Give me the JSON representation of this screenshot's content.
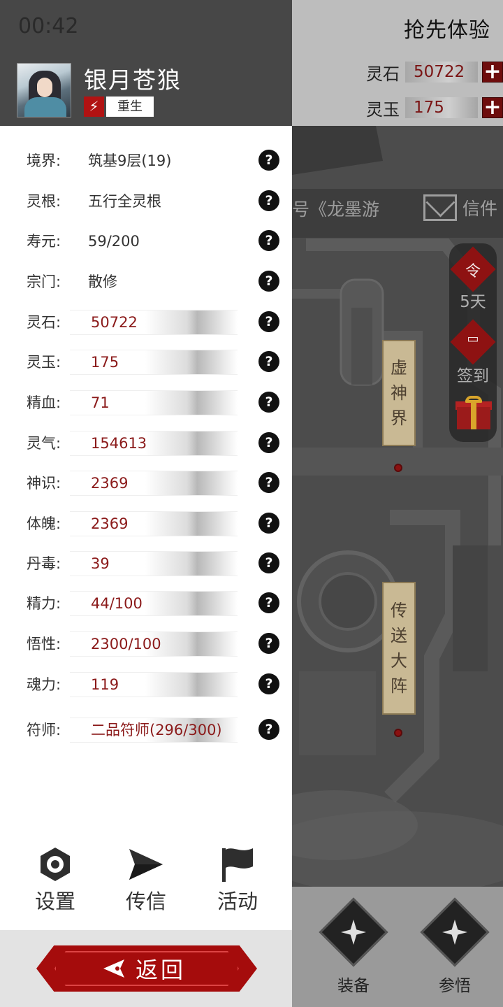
{
  "status_bar": {
    "time": "00:42"
  },
  "player": {
    "name": "银月苍狼",
    "status_icon": "lightning-icon",
    "status_label": "重生"
  },
  "stats": [
    {
      "label": "境界:",
      "value": "筑基9层(19)",
      "style": "plain"
    },
    {
      "label": "灵根:",
      "value": "五行全灵根",
      "style": "plain"
    },
    {
      "label": "寿元:",
      "value": "59/200",
      "style": "plain"
    },
    {
      "label": "宗门:",
      "value": "散修",
      "style": "plain"
    },
    {
      "label": "灵石:",
      "value": "50722",
      "style": "bar"
    },
    {
      "label": "灵玉:",
      "value": "175",
      "style": "bar"
    },
    {
      "label": "精血:",
      "value": "71",
      "style": "bar"
    },
    {
      "label": "灵气:",
      "value": "154613",
      "style": "bar"
    },
    {
      "label": "神识:",
      "value": "2369",
      "style": "bar"
    },
    {
      "label": "体魄:",
      "value": "2369",
      "style": "bar"
    },
    {
      "label": "丹毒:",
      "value": "39",
      "style": "bar"
    },
    {
      "label": "精力:",
      "value": "44/100",
      "style": "bar"
    },
    {
      "label": "悟性:",
      "value": "2300/100",
      "style": "bar"
    },
    {
      "label": "魂力:",
      "value": "119",
      "style": "bar"
    },
    {
      "label": "符师:",
      "value": "二品符师(296/300)",
      "style": "bar"
    }
  ],
  "help_glyph": "?",
  "menu": {
    "settings": {
      "label": "设置",
      "icon": "gear-icon"
    },
    "message": {
      "label": "传信",
      "icon": "paper-plane-icon"
    },
    "events": {
      "label": "活动",
      "icon": "flag-icon"
    }
  },
  "back_button": {
    "label": "返回",
    "icon": "arrow-left-icon"
  },
  "game": {
    "early_access": "抢先体验",
    "resources": [
      {
        "label": "灵石",
        "value": "50722",
        "plus": "+"
      },
      {
        "label": "灵玉",
        "value": "175",
        "plus": "+"
      }
    ],
    "banner_text": "号《龙墨游",
    "mail_label": "信件",
    "side_buttons": [
      {
        "glyph": "令",
        "label": "5天",
        "icon": "token-icon"
      },
      {
        "glyph": "",
        "label": "签到",
        "icon": "sign-in-icon"
      },
      {
        "glyph": "",
        "label": "",
        "icon": "gift-icon"
      }
    ],
    "map_signs": [
      {
        "chars": [
          "虚",
          "神",
          "界"
        ]
      },
      {
        "chars": [
          "传",
          "送",
          "大",
          "阵"
        ]
      }
    ],
    "bottom_buttons": [
      {
        "label": "装备",
        "icon": "equipment-icon"
      },
      {
        "label": "参悟",
        "icon": "comprehend-icon"
      }
    ],
    "colors": {
      "accent_red": "#a50c0c",
      "value_red": "#8b1a1a",
      "header_gray": "#474747"
    }
  }
}
